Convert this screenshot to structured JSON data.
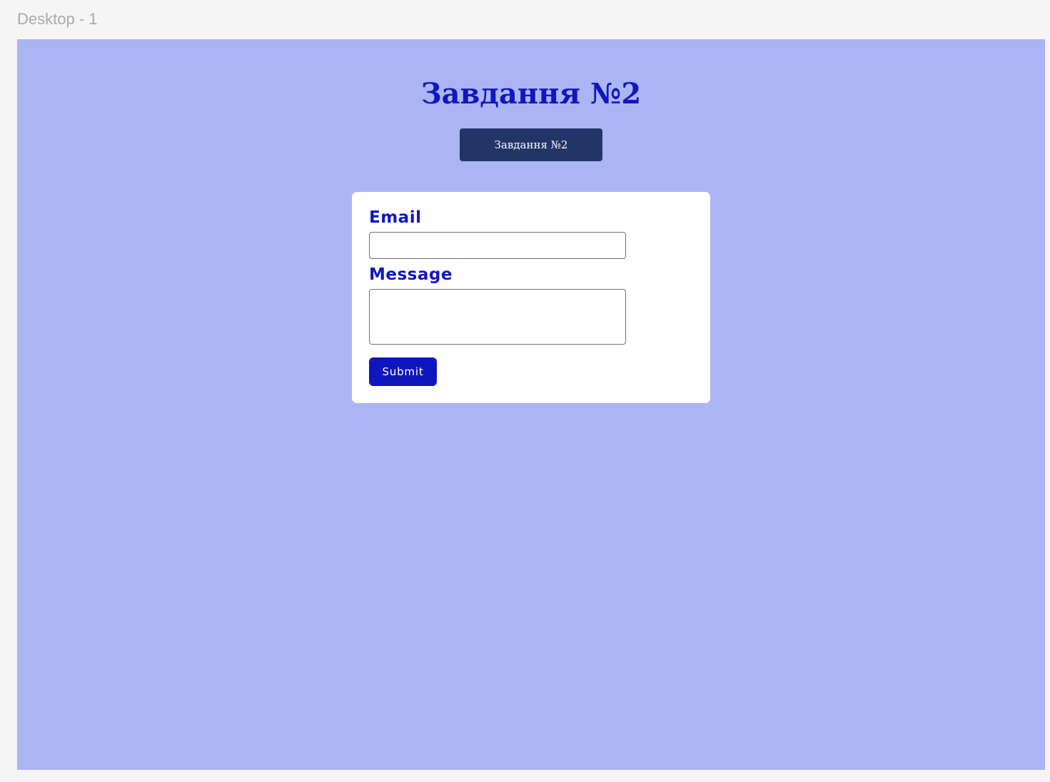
{
  "frame": {
    "label": "Desktop - 1",
    "background_color": "#abb5f4"
  },
  "header": {
    "title": "Завдання №2",
    "title_color": "#1116c0",
    "button_label": "Завдання №2",
    "button_color": "#213569"
  },
  "form": {
    "email_label": "Email",
    "email_value": "",
    "message_label": "Message",
    "message_value": "",
    "submit_label": "Submit",
    "submit_color": "#0f16bd"
  }
}
